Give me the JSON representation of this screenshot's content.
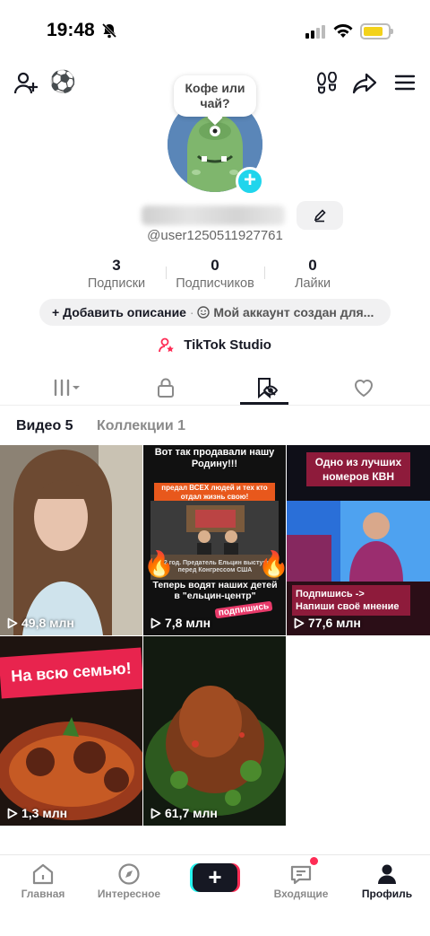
{
  "status_bar": {
    "time": "19:48",
    "battery_level": 0.8
  },
  "top_nav": {
    "add_friend_icon": "add-friend-icon",
    "ball_emoji": "⚽",
    "footprint_icon": "footprint-icon",
    "share_icon": "share-icon",
    "menu_icon": "menu-icon"
  },
  "profile": {
    "bubble_text": "Кофе или чай?",
    "username": "@user1250511927761",
    "stats": [
      {
        "value": "3",
        "label": "Подписки"
      },
      {
        "value": "0",
        "label": "Подписчиков"
      },
      {
        "value": "0",
        "label": "Лайки"
      }
    ],
    "add_description": "+ Добавить описание",
    "separator": "·",
    "account_created": "Мой аккаунт создан для...",
    "studio": "TikTok Studio"
  },
  "sub_tabs": {
    "videos": "Видео 5",
    "collections": "Коллекции 1"
  },
  "videos": [
    {
      "views": "49,8 млн",
      "caption": ""
    },
    {
      "views": "7,8 млн",
      "caption_top": "Вот так продавали нашу Родину!!!",
      "caption_orange": "предал ВСЕХ людей и тех кто отдал жизнь свою!",
      "caption_year": "1992 год. Предатель Ельцин выступает перед Конгрессом США",
      "caption_bottom": "Теперь водят наших детей в \"ельцин-центр\"",
      "subscribe": "подпишись"
    },
    {
      "views": "77,6 млн",
      "caption_top": "Одно из лучших номеров КВН",
      "caption_bottom": "Подпишись ->\nНапиши своё мнение"
    },
    {
      "views": "1,3 млн",
      "caption_top": "На всю семью!"
    },
    {
      "views": "61,7 млн",
      "caption": ""
    }
  ],
  "bottom_nav": [
    {
      "label": "Главная"
    },
    {
      "label": "Интересное"
    },
    {
      "label": "Входящие"
    },
    {
      "label": "Профиль"
    }
  ],
  "colors": {
    "accent": "#fe2c55",
    "cyan": "#20d5ec"
  }
}
